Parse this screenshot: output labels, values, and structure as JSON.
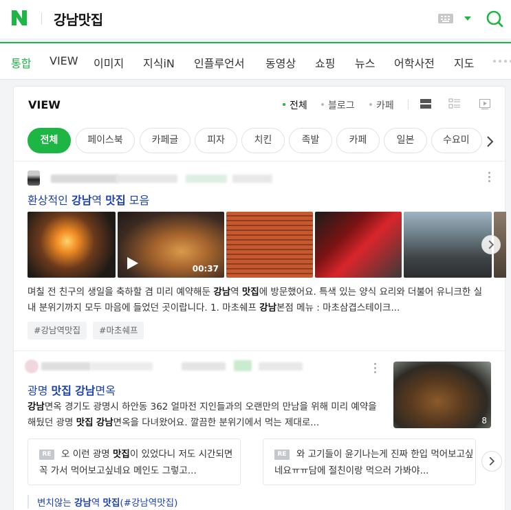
{
  "header": {
    "logo_text": "N",
    "query": "강남맛집"
  },
  "tabs": [
    {
      "label": "통합",
      "active": true
    },
    {
      "label": "VIEW"
    },
    {
      "label": "이미지"
    },
    {
      "label": "지식iN"
    },
    {
      "label": "인플루언서"
    },
    {
      "label": "동영상"
    },
    {
      "label": "쇼핑"
    },
    {
      "label": "뉴스"
    },
    {
      "label": "어학사전"
    },
    {
      "label": "지도"
    }
  ],
  "view": {
    "title": "VIEW",
    "filters": [
      {
        "label": "전체",
        "active": true
      },
      {
        "label": "블로그"
      },
      {
        "label": "카페"
      }
    ],
    "chips": [
      "전체",
      "페이스북",
      "카페글",
      "피자",
      "치킨",
      "족발",
      "카페",
      "일본",
      "수요미"
    ],
    "posts": [
      {
        "title_parts": [
          "환상적인 ",
          "강남",
          "역 ",
          "맛집",
          " 모음"
        ],
        "video_duration": "00:37",
        "desc_parts": [
          "며칠 전 친구의 생일을 축하할 겸 미리 예약해둔 ",
          "강남",
          "역 ",
          "맛집",
          "에 방문했어요. 특색 있는 양식 요리와 더불어 유니크한 실내 분위기까지 모두 마음에 들었던 곳이랍니다. 1. 마초쉐프 ",
          "강남",
          "본점 메뉴 : 마초삼겹스테이크..."
        ],
        "tags": [
          "#강남역맛집",
          "#마초쉐프"
        ]
      },
      {
        "title_parts": [
          "광명 ",
          "맛집",
          " ",
          "강남",
          "면옥"
        ],
        "desc_parts": [
          "강남",
          "면옥 경기도 광명시 하안동 362 얼마전 지인들과의 오랜만의 만남을 위해 미리 예약을 해뒀던 광명 ",
          "맛집",
          " ",
          "강남",
          "면옥을 다녀왔어요. 깔끔한 분위기에서 먹는 제대로..."
        ],
        "thumb_count": "8",
        "comments": [
          {
            "badge": "RE",
            "parts": [
              "오 이런 광명 ",
              "맛집",
              "이 있었다니 저도 시간되면 꼭 가서 먹어보고싶네요 메인도 그렇고..."
            ]
          },
          {
            "badge": "RE",
            "parts": [
              "와 고기들이 윤기나는게 진짜 한입 먹어보고싶네요ㅠㅠ담에 절친이랑 먹으러 가봐야..."
            ]
          }
        ]
      }
    ],
    "related_parts": [
      "변치않는 ",
      "강남",
      "역 ",
      "맛집",
      "(#강남역맛집)"
    ]
  },
  "colors": {
    "brand": "#1db543",
    "link": "#1a3fb3"
  },
  "icons": [
    "naver-logo-icon",
    "keyboard-icon",
    "caret-down-icon",
    "search-icon",
    "list-view-icon",
    "card-view-icon",
    "video-view-icon",
    "chevron-right-icon",
    "play-icon"
  ]
}
